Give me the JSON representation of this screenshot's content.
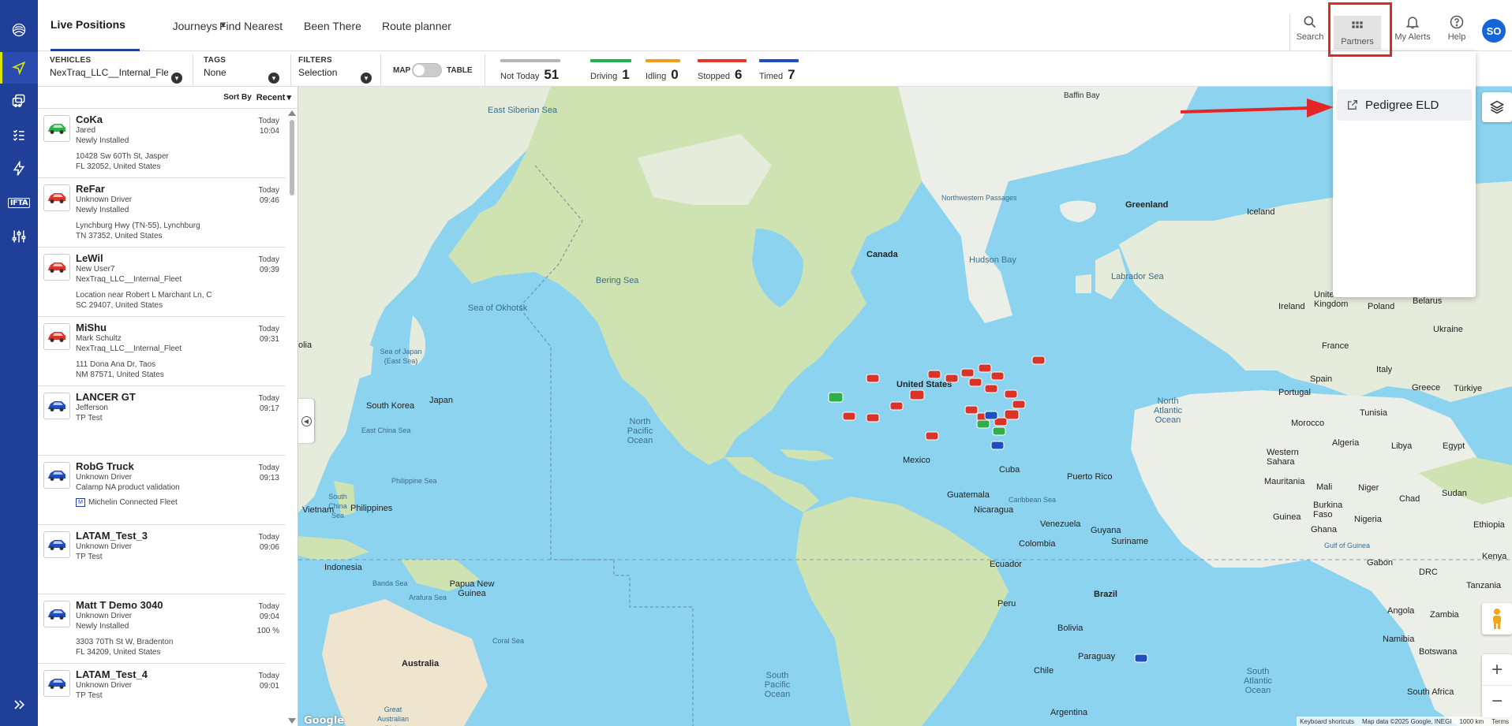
{
  "nav": {
    "tabs": [
      {
        "label": "Live Positions"
      },
      {
        "label": "Journeys"
      },
      {
        "label": "Find Nearest"
      },
      {
        "label": "Been There"
      },
      {
        "label": "Route planner"
      }
    ],
    "actions": {
      "search": "Search",
      "partners": "Partners",
      "alerts": "My Alerts",
      "help": "Help",
      "avatar": "SO"
    }
  },
  "filters": {
    "vehicles_label": "VEHICLES",
    "vehicles_value": "NexTraq_LLC__Internal_Fleet",
    "tags_label": "TAGS",
    "tags_value": "None",
    "filters_label": "FILTERS",
    "filters_value": "Selection",
    "map_label": "MAP",
    "table_label": "TABLE"
  },
  "stats": [
    {
      "label": "Not Today",
      "value": "51",
      "color": "#b5b5b5"
    },
    {
      "label": "Driving",
      "value": "1",
      "color": "#22b14c"
    },
    {
      "label": "Idling",
      "value": "0",
      "color": "#f29b1e"
    },
    {
      "label": "Stopped",
      "value": "6",
      "color": "#e5382a"
    },
    {
      "label": "Timed",
      "value": "7",
      "color": "#1f4fbf"
    }
  ],
  "sort": {
    "label": "Sort By",
    "value": "Recent"
  },
  "vehicles": [
    {
      "name": "CoKa",
      "line1": "Jared",
      "line2": "Newly Installed",
      "addr1": "10428 Sw 60Th St, Jasper",
      "addr2": "FL 32052, United States",
      "day": "Today",
      "time": "10:04",
      "color": "#2fae4a"
    },
    {
      "name": "ReFar",
      "line1": "Unknown Driver",
      "line2": "Newly Installed",
      "addr1": "Lynchburg Hwy (TN-55), Lynchburg",
      "addr2": "TN 37352, United States",
      "day": "Today",
      "time": "09:46",
      "color": "#d8342a"
    },
    {
      "name": "LeWil",
      "line1": "New User7",
      "line2": "NexTraq_LLC__Internal_Fleet",
      "addr1": "Location near Robert L Marchant Ln, C",
      "addr2": "SC 29407, United States",
      "day": "Today",
      "time": "09:39",
      "color": "#d8342a"
    },
    {
      "name": "MiShu",
      "line1": "Mark Schultz",
      "line2": "NexTraq_LLC__Internal_Fleet",
      "addr1": "111 Dona Ana Dr, Taos",
      "addr2": "NM 87571, United States",
      "day": "Today",
      "time": "09:31",
      "color": "#d8342a"
    },
    {
      "name": "LANCER GT",
      "line1": "Jefferson",
      "line2": "TP Test",
      "addr1": "",
      "addr2": "",
      "day": "Today",
      "time": "09:17",
      "color": "#1f4fbf"
    },
    {
      "name": "RobG Truck",
      "line1": "Unknown Driver",
      "line2": "Calamp NA product validation",
      "partner": "Michelin Connected Fleet",
      "day": "Today",
      "time": "09:13",
      "color": "#1f4fbf"
    },
    {
      "name": "LATAM_Test_3",
      "line1": "Unknown Driver",
      "line2": "TP Test",
      "addr1": "",
      "addr2": "",
      "day": "Today",
      "time": "09:06",
      "color": "#1f4fbf"
    },
    {
      "name": "Matt T Demo 3040",
      "line1": "Unknown Driver",
      "line2": "Newly Installed",
      "addr1": "3303 70Th St W, Bradenton",
      "addr2": "FL 34209, United States",
      "day": "Today",
      "time": "09:04",
      "pct": "100 %",
      "color": "#1f4fbf"
    },
    {
      "name": "LATAM_Test_4",
      "line1": "Unknown Driver",
      "line2": "TP Test",
      "addr1": "",
      "addr2": "",
      "day": "Today",
      "time": "09:01",
      "color": "#1f4fbf"
    }
  ],
  "partners_menu": {
    "item": "Pedigree ELD"
  },
  "map": {
    "labels": {
      "baffin_bay": "Baffin Bay",
      "east_siberian_sea": "East Siberian Sea",
      "greenland": "Greenland",
      "iceland": "Iceland",
      "northwestern_passages": "Northwestern Passages",
      "hudson_bay": "Hudson Bay",
      "labrador_sea": "Labrador Sea",
      "canada": "Canada",
      "bering_sea": "Bering Sea",
      "sea_of_okhotsk": "Sea of Okhotsk",
      "ireland": "Ireland",
      "united_kingdom": "United Kingdom",
      "poland": "Poland",
      "belarus": "Belarus",
      "france": "France",
      "ukraine": "Ukraine",
      "italy": "Italy",
      "portugal": "Portugal",
      "spain": "Spain",
      "greece": "Greece",
      "turkiye": "Türkiye",
      "morocco": "Morocco",
      "tunisia": "Tunisia",
      "algeria": "Algeria",
      "libya": "Libya",
      "egypt": "Egypt",
      "western_sahara": "Western Sahara",
      "mauritania": "Mauritania",
      "mali": "Mali",
      "niger": "Niger",
      "chad": "Chad",
      "sudan": "Sudan",
      "burkina_faso": "Burkina Faso",
      "nigeria": "Nigeria",
      "ethiopia": "Ethiopia",
      "guinea": "Guinea",
      "ghana": "Ghana",
      "gulf_of_guinea": "Gulf of Guinea",
      "gabon": "Gabon",
      "kenya": "Kenya",
      "drc": "DRC",
      "tanzania": "Tanzania",
      "angola": "Angola",
      "zambia": "Zambia",
      "namibia": "Namibia",
      "botswana": "Botswana",
      "south_africa": "South Africa",
      "united_states": "United States",
      "mexico": "Mexico",
      "cuba": "Cuba",
      "puerto_rico": "Puerto Rico",
      "guatemala": "Guatemala",
      "caribbean_sea": "Caribbean Sea",
      "nicaragua": "Nicaragua",
      "venezuela": "Venezuela",
      "guyana": "Guyana",
      "suriname": "Suriname",
      "colombia": "Colombia",
      "ecuador": "Ecuador",
      "peru": "Peru",
      "brazil": "Brazil",
      "bolivia": "Bolivia",
      "paraguay": "Paraguay",
      "chile": "Chile",
      "argentina": "Argentina",
      "north_pacific_ocean": "North Pacific Ocean",
      "north_atlantic_ocean": "North Atlantic Ocean",
      "south_pacific_ocean": "South Pacific Ocean",
      "south_atlantic_ocean": "South Atlantic Ocean",
      "sea_of_japan": "Sea of Japan (East Sea)",
      "japan": "Japan",
      "south_korea": "South Korea",
      "east_china_sea": "East China Sea",
      "philippine_sea": "Philippine Sea",
      "south_china_sea": "South China Sea",
      "vietnam": "Vietnam",
      "philippines": "Philippines",
      "indonesia": "Indonesia",
      "banda_sea": "Banda Sea",
      "papua_new_guinea": "Papua New Guinea",
      "arafura_sea": "Arafura Sea",
      "coral_sea": "Coral Sea",
      "australia": "Australia",
      "great_australian_bight": "Great Australian Bight",
      "mongolia": "olia"
    },
    "attribution": {
      "shortcuts": "Keyboard shortcuts",
      "data": "Map data ©2025 Google, INEGI",
      "scale": "1000 km",
      "terms": "Terms"
    },
    "google": "Google"
  }
}
